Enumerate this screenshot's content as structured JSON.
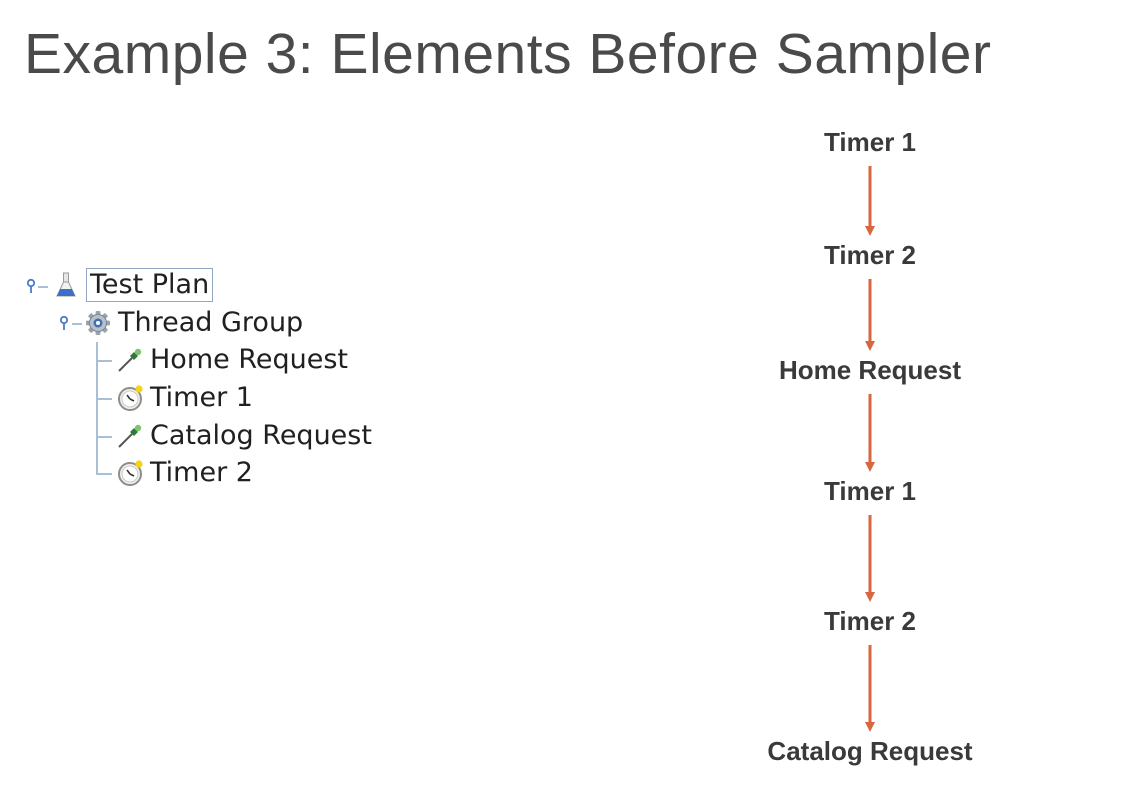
{
  "title": "Example 3: Elements Before Sampler",
  "tree": {
    "items": [
      {
        "label": "Test Plan",
        "icon": "flask-icon",
        "selected": true
      },
      {
        "label": "Thread Group",
        "icon": "gear-icon"
      },
      {
        "label": "Home Request",
        "icon": "pipette-icon"
      },
      {
        "label": "Timer 1",
        "icon": "stopwatch-icon"
      },
      {
        "label": "Catalog Request",
        "icon": "pipette-icon"
      },
      {
        "label": "Timer 2",
        "icon": "stopwatch-icon"
      }
    ]
  },
  "flow": {
    "steps": [
      "Timer 1",
      "Timer 2",
      "Home Request",
      "Timer 1",
      "Timer 2",
      "Catalog Request"
    ],
    "arrow_color": "#d8663f"
  }
}
